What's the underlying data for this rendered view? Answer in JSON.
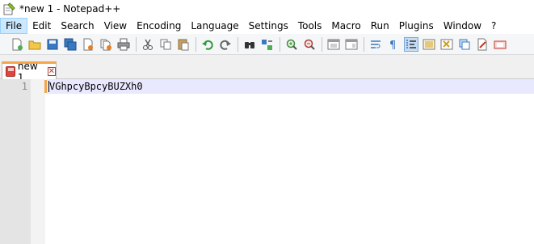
{
  "window": {
    "title": "*new 1 - Notepad++"
  },
  "menu": [
    "File",
    "Edit",
    "Search",
    "View",
    "Encoding",
    "Language",
    "Settings",
    "Tools",
    "Macro",
    "Run",
    "Plugins",
    "Window",
    "?"
  ],
  "toolbar": {
    "icons": [
      "new-file-icon",
      "open-file-icon",
      "save-icon",
      "save-all-icon",
      "close-icon",
      "close-all-icon",
      "print-icon",
      "cut-icon",
      "copy-icon",
      "paste-icon",
      "undo-icon",
      "redo-icon",
      "find-icon",
      "replace-icon",
      "zoom-in-icon",
      "zoom-out-icon",
      "sync-vertical-icon",
      "sync-horizontal-icon",
      "word-wrap-icon",
      "show-all-chars-icon",
      "indent-guide-icon",
      "language-icon",
      "function-list-icon",
      "folder-workspace-icon",
      "record-macro-icon",
      "stop-macro-icon"
    ],
    "active_icon": "indent-guide-icon"
  },
  "tab": {
    "label": "new 1",
    "close_glyph": "✕"
  },
  "editor": {
    "lines": [
      {
        "number": "1",
        "text": "VGhpcyBpcyBUZXh0"
      }
    ]
  },
  "colors": {
    "accent": "#f7a54a",
    "current_line": "#e8e8ff",
    "gutter": "#e4e4e4",
    "menu_highlight": "#cce8ff"
  }
}
